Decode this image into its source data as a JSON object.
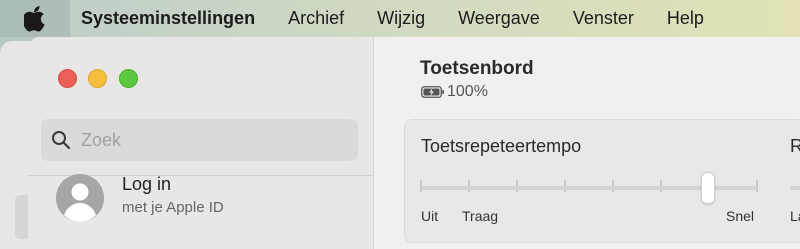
{
  "menubar": {
    "apple_icon": "apple-logo-icon",
    "app_name": "Systeeminstellingen",
    "items": [
      "Archief",
      "Wijzig",
      "Weergave",
      "Venster",
      "Help"
    ]
  },
  "sidebar": {
    "search": {
      "placeholder": "Zoek",
      "value": "",
      "icon": "search-icon"
    },
    "account": {
      "title": "Log in",
      "subtitle": "met je Apple ID",
      "icon": "person-avatar-icon"
    }
  },
  "main": {
    "title": "Toetsenbord",
    "battery": {
      "icon": "battery-charging-icon",
      "text": "100%"
    },
    "key_repeat": {
      "title": "Toetsrepeteertempo",
      "second_title_partial": "R",
      "labels": {
        "off": "Uit",
        "slow": "Traag",
        "fast": "Snel",
        "partial_next": "La"
      },
      "tick_count": 8,
      "value_fraction": 0.85
    }
  },
  "colors": {
    "close": "#ec5f57",
    "minimize": "#f5be3b",
    "maximize": "#5cc83f"
  }
}
